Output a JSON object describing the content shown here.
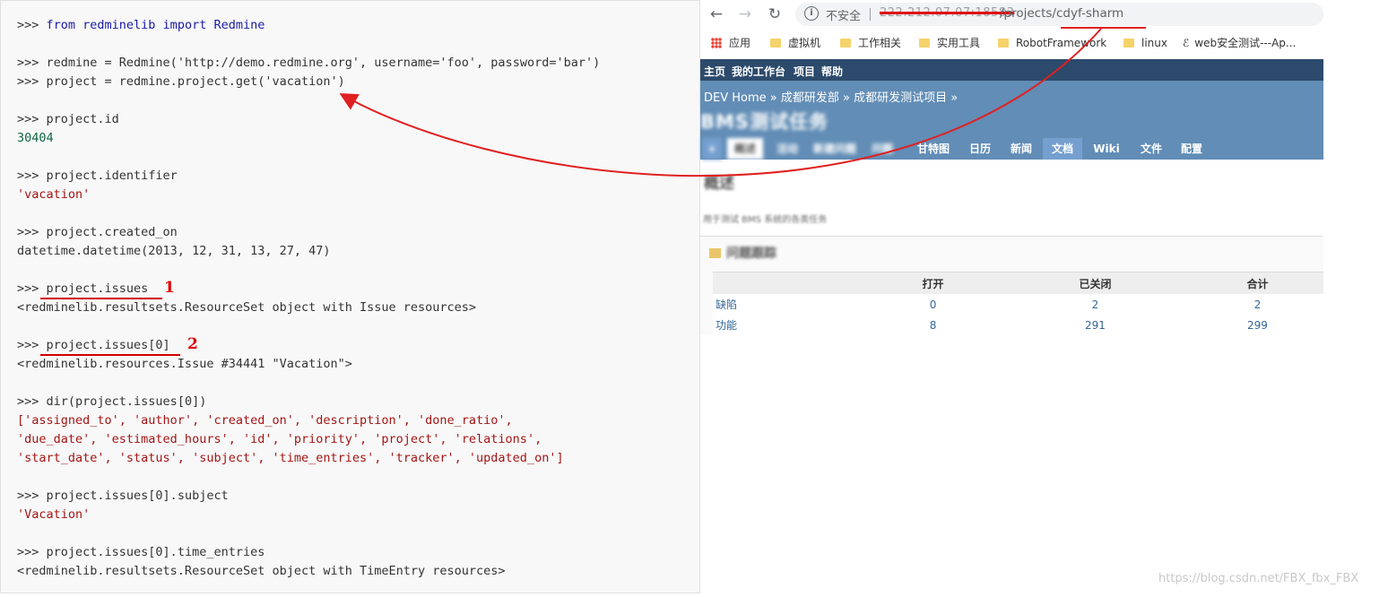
{
  "code": {
    "lines": [
      {
        "prompt": ">>> ",
        "text": "from redminelib import Redmine"
      },
      {
        "prompt": ">>> ",
        "text": "redmine = Redmine('http://demo.redmine.org', username='foo', password='bar')"
      },
      {
        "prompt": ">>> ",
        "text": "project = redmine.project.get('vacation')"
      },
      {
        "prompt": ">>> ",
        "text": "project.id"
      },
      {
        "prompt": "",
        "text": "30404"
      },
      {
        "prompt": ">>> ",
        "text": "project.identifier"
      },
      {
        "prompt": "",
        "text": "'vacation'"
      },
      {
        "prompt": ">>> ",
        "text": "project.created_on"
      },
      {
        "prompt": "",
        "text": "datetime.datetime(2013, 12, 31, 13, 27, 47)"
      },
      {
        "prompt": ">>> ",
        "text": "project.issues"
      },
      {
        "prompt": "",
        "text": "<redminelib.resultsets.ResourceSet object with Issue resources>"
      },
      {
        "prompt": ">>> ",
        "text": "project.issues[0]"
      },
      {
        "prompt": "",
        "text": "<redminelib.resources.Issue #34441 \"Vacation\">"
      },
      {
        "prompt": ">>> ",
        "text": "dir(project.issues[0])"
      },
      {
        "prompt": "",
        "text": "['assigned_to', 'author', 'created_on', 'description', 'done_ratio',"
      },
      {
        "prompt": "",
        "text": "'due_date', 'estimated_hours', 'id', 'priority', 'project', 'relations',"
      },
      {
        "prompt": "",
        "text": "'start_date', 'status', 'subject', 'time_entries', 'tracker', 'updated_on']"
      },
      {
        "prompt": ">>> ",
        "text": "project.issues[0].subject"
      },
      {
        "prompt": "",
        "text": "'Vacation'"
      },
      {
        "prompt": ">>> ",
        "text": "project.issues[0].time_entries"
      },
      {
        "prompt": "",
        "text": "<redminelib.resultsets.ResourceSet object with TimeEntry resources>"
      }
    ],
    "annotations": [
      "1",
      "2"
    ]
  },
  "browser": {
    "insecure_label": "不安全",
    "host": "222.212.07.07:18583",
    "path": "/projects/cdyf-sharm",
    "bookmarks": [
      "应用",
      "虚拟机",
      "工作相关",
      "实用工具",
      "RobotFramework",
      "linux",
      "web安全测试---Ap..."
    ]
  },
  "redmine": {
    "top_menu": [
      "主页",
      "我的工作台",
      "项目",
      "帮助"
    ],
    "breadcrumb": "DEV Home » 成都研发部 » 成都研发测试项目 »",
    "project_title": "BMS测试任务",
    "tabs": [
      "+",
      "概述",
      "活动",
      "新建问题",
      "问题",
      "甘特图",
      "日历",
      "新闻",
      "文档",
      "Wiki",
      "文件",
      "配置"
    ],
    "overview_heading": "概述",
    "description": "用于测试 BMS 系统的各类任务",
    "issues_box_title": "问题跟踪",
    "table": {
      "headers": [
        "",
        "打开",
        "已关闭",
        "合计"
      ],
      "rows": [
        {
          "tracker": "缺陷",
          "open": "0",
          "closed": "2",
          "total": "2"
        },
        {
          "tracker": "功能",
          "open": "8",
          "closed": "291",
          "total": "299"
        }
      ]
    }
  },
  "watermark": "https://blog.csdn.net/FBX_fbx_FBX",
  "colors": {
    "annotation": "#e00000",
    "redmine_header": "#628db6",
    "redmine_topbar": "#2c4a6b"
  }
}
